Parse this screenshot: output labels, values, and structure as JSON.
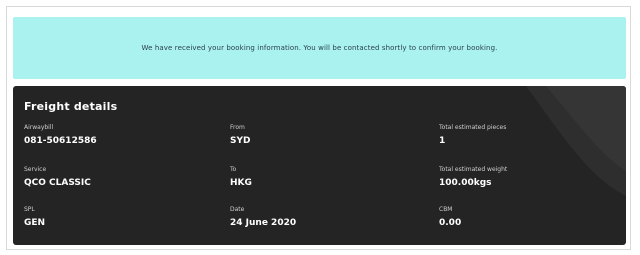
{
  "notice": {
    "message": "We have received your booking information. You will be contacted shortly to confirm your booking."
  },
  "freight": {
    "title": "Freight details",
    "fields": [
      {
        "label": "Airwaybill",
        "value": "081-50612586"
      },
      {
        "label": "From",
        "value": "SYD"
      },
      {
        "label": "Total estimated pieces",
        "value": "1"
      },
      {
        "label": "Service",
        "value": "QCO CLASSIC"
      },
      {
        "label": "To",
        "value": "HKG"
      },
      {
        "label": "Total estimated weight",
        "value": "100.00kgs"
      },
      {
        "label": "SPL",
        "value": "GEN"
      },
      {
        "label": "Date",
        "value": "24 June 2020"
      },
      {
        "label": "CBM",
        "value": "0.00"
      }
    ]
  },
  "colors": {
    "notice_bg": "#a9f2ef",
    "panel_bg": "#242424",
    "text_light": "#ffffff"
  }
}
